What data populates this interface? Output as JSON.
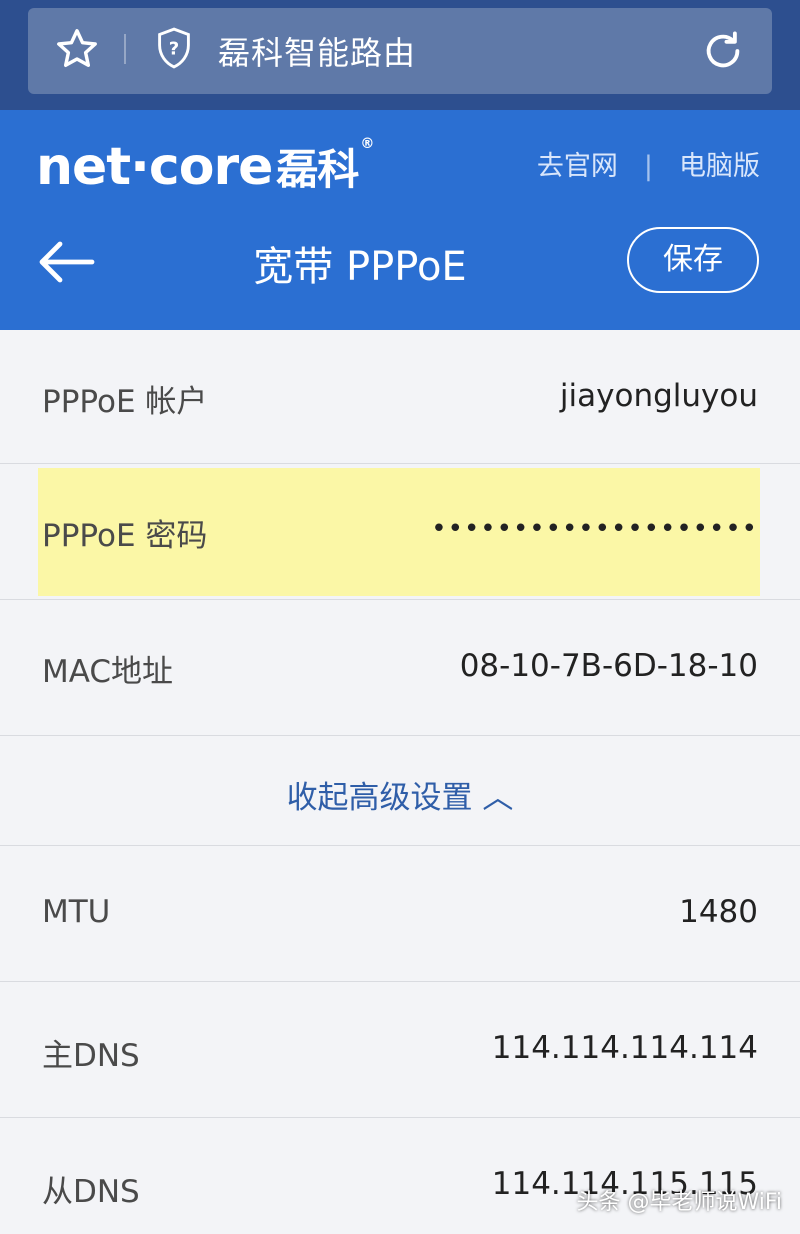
{
  "browser": {
    "url_text": "磊科智能路由",
    "icons": [
      "star-icon",
      "shield-icon",
      "reload-icon"
    ]
  },
  "header": {
    "logo_text": "net·core",
    "logo_cn": "磊科",
    "logo_reg": "®",
    "link_official": "去官网",
    "link_separator": "|",
    "link_desktop": "电脑版",
    "title": "宽带 PPPoE",
    "save_label": "保存",
    "color": "#2b6fd2"
  },
  "form": {
    "account_label": "PPPoE 帐户",
    "account_value": "jiayongluyou",
    "password_label": "PPPoE 密码",
    "password_value": "••••••••••••••••••••",
    "mac_label": "MAC地址",
    "mac_value": "08-10-7B-6D-18-10",
    "advanced_toggle": "收起高级设置 ︿",
    "mtu_label": "MTU",
    "mtu_value": "1480",
    "dns1_label": "主DNS",
    "dns1_value": "114.114.114.114",
    "dns2_label": "从DNS",
    "dns2_value": "114.114.115.115"
  },
  "overlay": {
    "watermark": "头条 @毕老师说WiFi"
  }
}
